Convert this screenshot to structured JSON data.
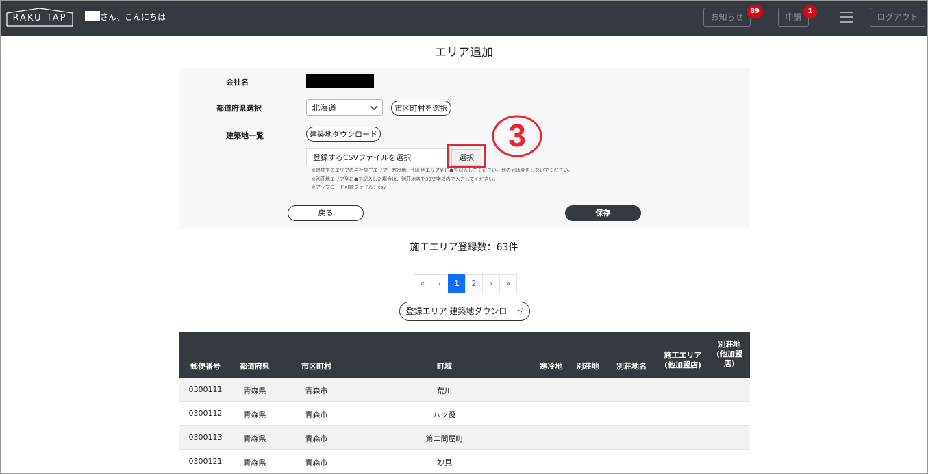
{
  "header": {
    "logo_text": "RAKU TAP",
    "greeting": "さん、こんにちは",
    "notices_label": "お知らせ",
    "notices_count": "89",
    "applications_label": "申請",
    "applications_count": "1",
    "logout_label": "ログアウト"
  },
  "page": {
    "title": "エリア追加"
  },
  "form": {
    "company_label": "会社名",
    "prefecture_label": "都道府県選択",
    "prefecture_value": "北海道",
    "city_button": "市区町村を選択",
    "sites_label": "建築地一覧",
    "sites_download_button": "建築地ダウンロード",
    "file_placeholder": "登録するCSVファイルを選択",
    "file_button": "選択",
    "callout_number": "3",
    "notes": [
      "※追加するエリアの自社施工エリア、寒冷地、別荘地エリア列に●を記入してください。他の列は変更しないでください。",
      "※別荘地エリア列に●を記入した場合は、別荘地名を30文字以内で入力してください。",
      "※アップロード可能ファイル：csv"
    ],
    "back_button": "戻る",
    "save_button": "保存"
  },
  "summary": {
    "count_text": "施工エリア登録数：63件"
  },
  "pagination": {
    "first": "«",
    "prev": "‹",
    "pages": [
      "1",
      "2"
    ],
    "next": "›",
    "last": "»"
  },
  "download_all_button": "登録エリア 建築地ダウンロード",
  "table": {
    "headers": {
      "zip": "郵便番号",
      "pref": "都道府県",
      "city": "市区町村",
      "town": "町域",
      "cold": "寒冷地",
      "resort": "別荘地",
      "resort_name": "別荘地名",
      "area_line1": "施工エリア",
      "area_line2": "(他加盟店)",
      "resort_other_line1": "別荘地",
      "resort_other_line2": "(他加盟",
      "resort_other_line3": "店)"
    },
    "rows": [
      {
        "zip": "0300111",
        "pref": "青森県",
        "city": "青森市",
        "town": "荒川"
      },
      {
        "zip": "0300112",
        "pref": "青森県",
        "city": "青森市",
        "town": "八ツ役"
      },
      {
        "zip": "0300113",
        "pref": "青森県",
        "city": "青森市",
        "town": "第二問屋町"
      },
      {
        "zip": "0300121",
        "pref": "青森県",
        "city": "青森市",
        "town": "妙見"
      }
    ]
  },
  "colors": {
    "header_bg": "#343a40",
    "badge": "#e3000f",
    "highlight": "#e8262c",
    "pager_active": "#0d6efd"
  }
}
